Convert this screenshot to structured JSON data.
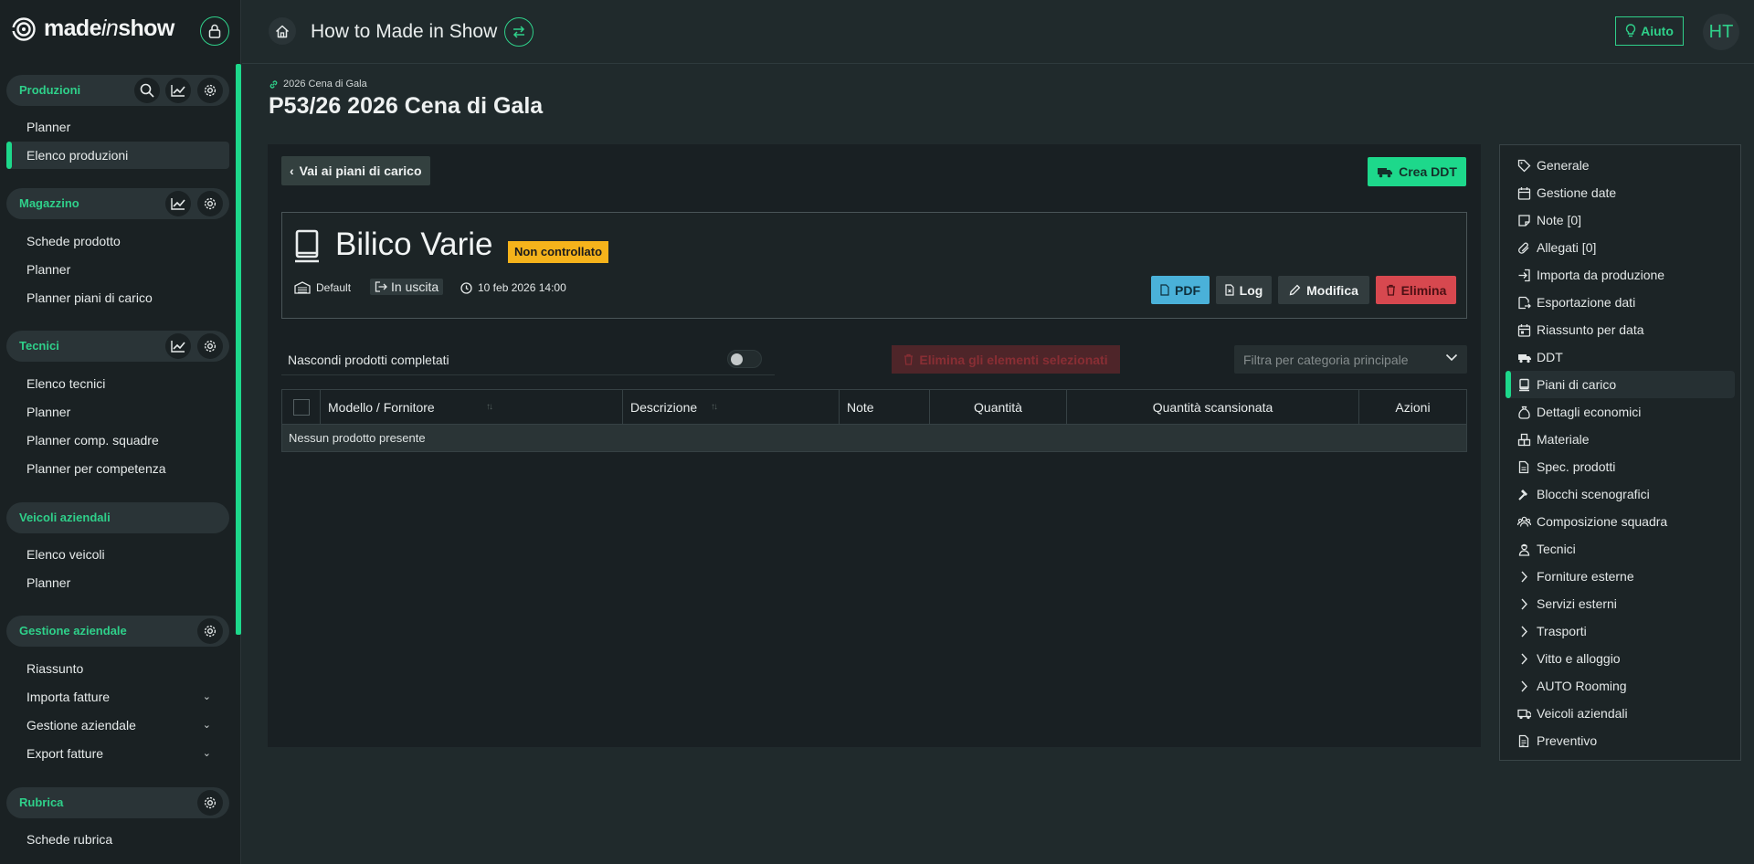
{
  "sidebar": {
    "logo": {
      "text_a": "made",
      "text_b": "in",
      "text_c": "show"
    },
    "sections": [
      {
        "title": "Produzioni",
        "items": [
          "Planner",
          "Elenco produzioni"
        ],
        "active_item": "Elenco produzioni"
      },
      {
        "title": "Magazzino",
        "items": [
          "Schede prodotto",
          "Planner",
          "Planner piani di carico"
        ]
      },
      {
        "title": "Tecnici",
        "items": [
          "Elenco tecnici",
          "Planner",
          "Planner comp. squadre",
          "Planner per competenza"
        ]
      },
      {
        "title": "Veicoli aziendali",
        "items": [
          "Elenco veicoli",
          "Planner"
        ]
      },
      {
        "title": "Gestione aziendale",
        "items": [
          "Riassunto",
          "Importa fatture",
          "Gestione aziendale",
          "Export fatture"
        ]
      },
      {
        "title": "Rubrica",
        "items": [
          "Schede rubrica"
        ]
      }
    ]
  },
  "topbar": {
    "title": "How to Made in Show",
    "help_label": "Aiuto",
    "avatar_initials": "HT"
  },
  "header": {
    "breadcrumb": "2026 Cena di Gala",
    "title": "P53/26 2026 Cena di Gala"
  },
  "main": {
    "back_label": "Vai ai piani di carico",
    "create_ddt_label": "Crea DDT",
    "card": {
      "title": "Bilico Varie",
      "badge": "Non controllato",
      "location": "Default",
      "direction": "In uscita",
      "datetime": "10 feb 2026 14:00",
      "actions": {
        "pdf": "PDF",
        "log": "Log",
        "edit": "Modifica",
        "delete": "Elimina"
      }
    },
    "hide_completed_label": "Nascondi prodotti completati",
    "hide_completed_on": false,
    "bulk_delete_label": "Elimina gli elementi selezionati",
    "category_filter_placeholder": "Filtra per categoria principale",
    "table": {
      "columns": [
        "Modello / Fornitore",
        "Descrizione",
        "Note",
        "Quantità",
        "Quantità scansionata",
        "Azioni"
      ],
      "empty_message": "Nessun prodotto presente"
    }
  },
  "right_nav": {
    "active": "Piani di carico",
    "items": [
      {
        "label": "Generale",
        "icon": "tag-icon"
      },
      {
        "label": "Gestione date",
        "icon": "calendar-icon"
      },
      {
        "label": "Note [0]",
        "icon": "note-icon"
      },
      {
        "label": "Allegati [0]",
        "icon": "paperclip-icon"
      },
      {
        "label": "Importa da produzione",
        "icon": "import-icon"
      },
      {
        "label": "Esportazione dati",
        "icon": "export-icon"
      },
      {
        "label": "Riassunto per data",
        "icon": "calendar-summary-icon"
      },
      {
        "label": "DDT",
        "icon": "truck-icon"
      },
      {
        "label": "Piani di carico",
        "icon": "bookmark-icon"
      },
      {
        "label": "Dettagli economici",
        "icon": "money-bag-icon"
      },
      {
        "label": "Materiale",
        "icon": "boxes-icon"
      },
      {
        "label": "Spec. prodotti",
        "icon": "document-icon"
      },
      {
        "label": "Blocchi scenografici",
        "icon": "hammer-icon"
      },
      {
        "label": "Composizione squadra",
        "icon": "team-icon"
      },
      {
        "label": "Tecnici",
        "icon": "worker-icon"
      },
      {
        "label": "Forniture esterne",
        "icon": "chevron-right-icon"
      },
      {
        "label": "Servizi esterni",
        "icon": "chevron-right-icon"
      },
      {
        "label": "Trasporti",
        "icon": "chevron-right-icon"
      },
      {
        "label": "Vitto e alloggio",
        "icon": "chevron-right-icon"
      },
      {
        "label": "AUTO Rooming",
        "icon": "chevron-right-icon"
      },
      {
        "label": "Veicoli aziendali",
        "icon": "van-icon"
      },
      {
        "label": "Preventivo",
        "icon": "invoice-icon"
      }
    ]
  },
  "colors": {
    "accent": "#1dd88b",
    "background": "#202a2c",
    "sidebar": "#1a2123",
    "badge_warning": "#f5b31b",
    "pdf_button": "#4ab1d9",
    "danger": "#d7484f"
  }
}
